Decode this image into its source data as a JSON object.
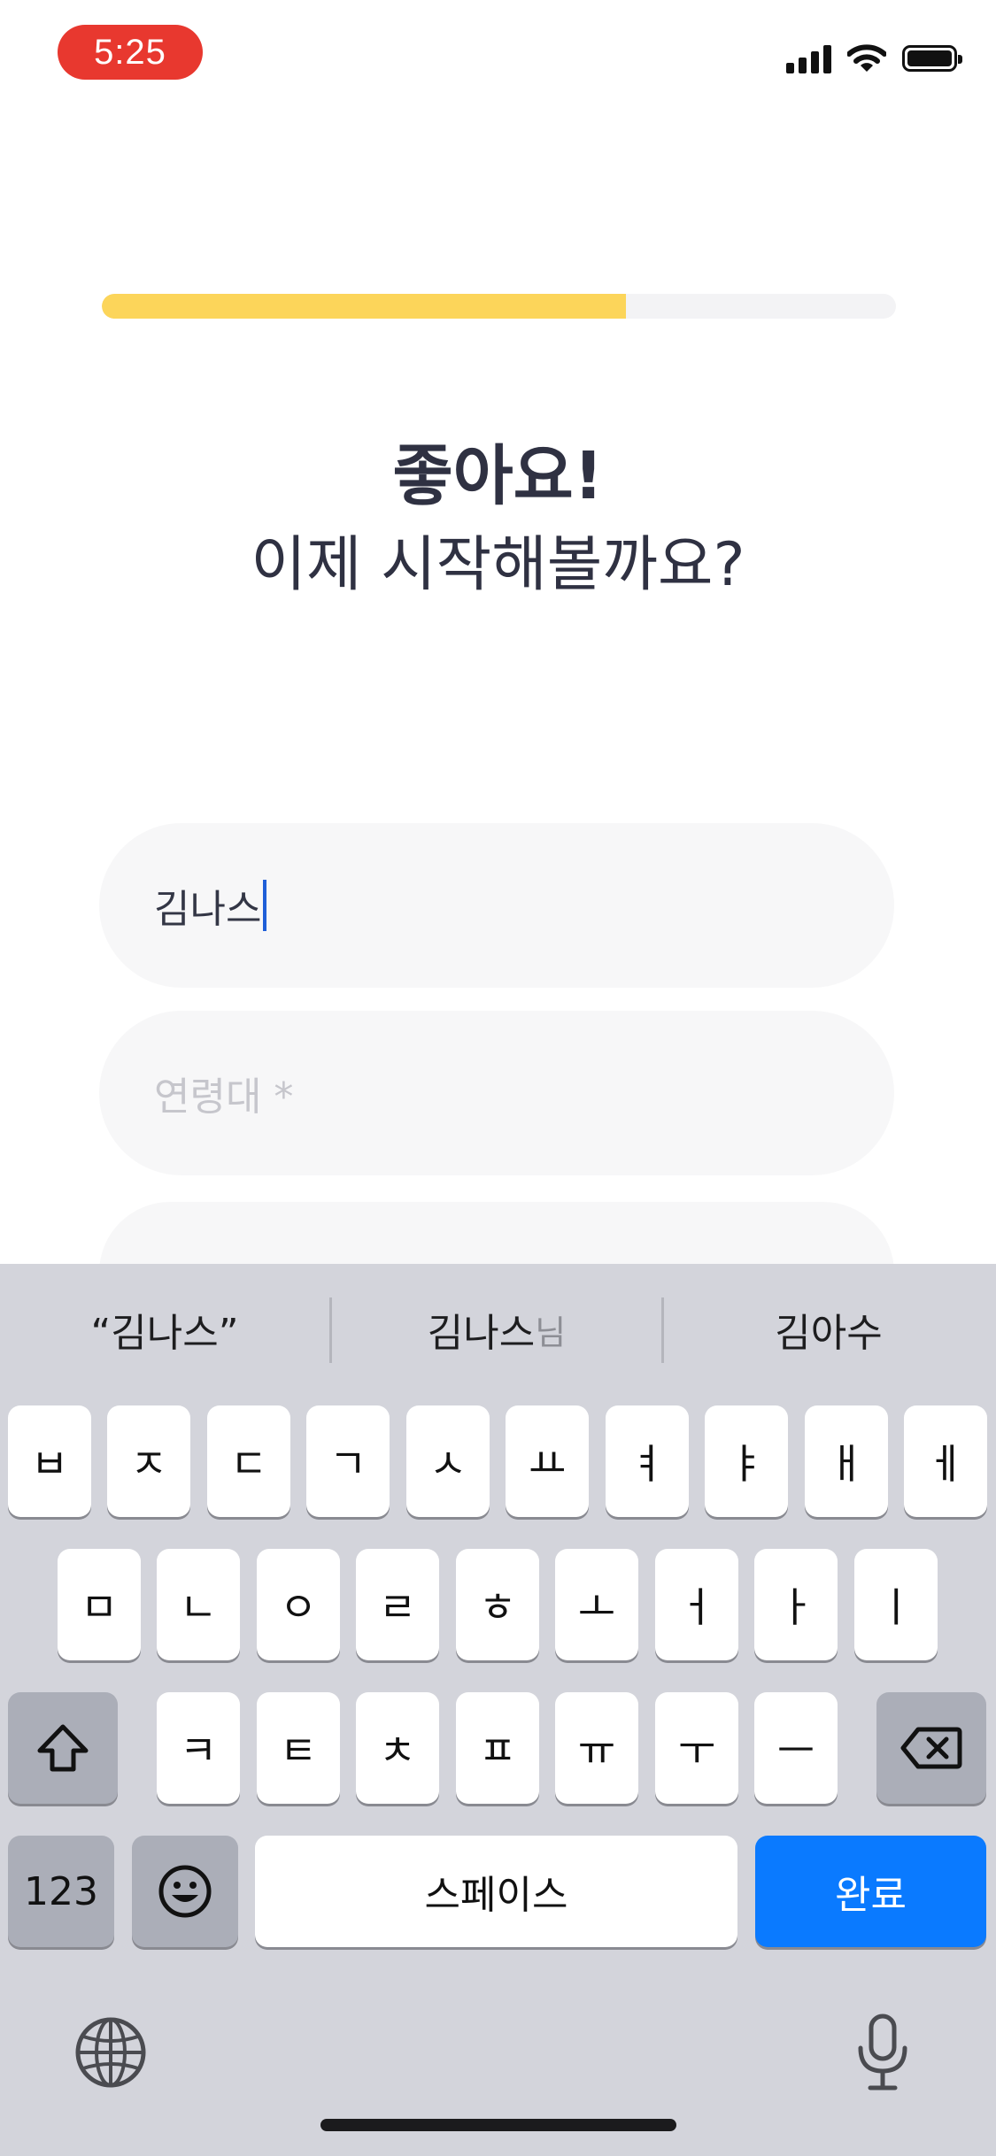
{
  "status_bar": {
    "time": "5:25",
    "icons": [
      "signal-icon",
      "wifi-icon",
      "battery-icon"
    ]
  },
  "onboarding": {
    "progress": 0.66,
    "title": "좋아요!",
    "subtitle": "이제 시작해볼까요?",
    "name_field": {
      "value": "김나스"
    },
    "age_field": {
      "placeholder": "연령대 *"
    }
  },
  "keyboard": {
    "suggestions": [
      {
        "main": "“김나스”",
        "dim": ""
      },
      {
        "main": "김나스",
        "dim": "님"
      },
      {
        "main": "김아수",
        "dim": ""
      }
    ],
    "row1": [
      "ㅂ",
      "ㅈ",
      "ㄷ",
      "ㄱ",
      "ㅅ",
      "ㅛ",
      "ㅕ",
      "ㅑ",
      "ㅐ",
      "ㅔ"
    ],
    "row2": [
      "ㅁ",
      "ㄴ",
      "ㅇ",
      "ㄹ",
      "ㅎ",
      "ㅗ",
      "ㅓ",
      "ㅏ",
      "ㅣ"
    ],
    "row3": [
      "ㅋ",
      "ㅌ",
      "ㅊ",
      "ㅍ",
      "ㅠ",
      "ㅜ",
      "ㅡ"
    ],
    "numbers_label": "123",
    "space_label": "스페이스",
    "done_label": "완료",
    "icons": [
      "shift-icon",
      "backspace-icon",
      "emoji-icon",
      "globe-icon",
      "microphone-icon"
    ]
  },
  "colors": {
    "progress_fill": "#fcd55a",
    "time_pill": "#e8382f",
    "done_key": "#0a7aff",
    "caret": "#1f5fd8"
  }
}
